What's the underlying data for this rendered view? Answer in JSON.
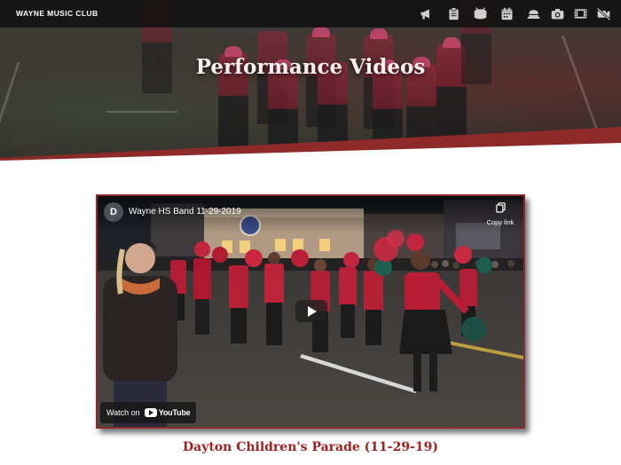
{
  "header": {
    "brand": "WAYNE MUSIC CLUB",
    "nav_icons": [
      "megaphone-icon",
      "clipboard-icon",
      "drum-icon",
      "calendar-icon",
      "hat-icon",
      "camera-icon",
      "film-icon",
      "video-off-icon"
    ]
  },
  "hero": {
    "title": "Performance Videos"
  },
  "video": {
    "channel_initial": "D",
    "title": "Wayne HS Band 11-29-2019",
    "copy_link_label": "Copy link",
    "watch_on_label": "Watch on",
    "youtube_label": "YouTube"
  },
  "caption": "Dayton Children's Parade (11-29-19)",
  "colors": {
    "accent": "#a21f1f",
    "frame_border": "#8e2a2a",
    "navbar": "#121212"
  }
}
